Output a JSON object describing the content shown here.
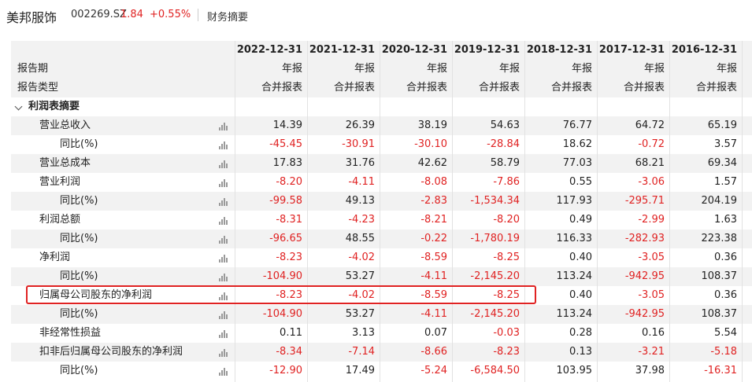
{
  "header": {
    "name": "美邦服饰",
    "code": "002269.SZ",
    "price": "1.84",
    "change": "+0.55%",
    "tab": "财务摘要"
  },
  "table": {
    "dates": [
      "2022-12-31",
      "2021-12-31",
      "2020-12-31",
      "2019-12-31",
      "2018-12-31",
      "2017-12-31",
      "2016-12-31"
    ],
    "period_label": "报告期",
    "period_values": [
      "年报",
      "年报",
      "年报",
      "年报",
      "年报",
      "年报",
      "年报"
    ],
    "type_label": "报告类型",
    "type_values": [
      "合并报表",
      "合并报表",
      "合并报表",
      "合并报表",
      "合并报表",
      "合并报表",
      "合并报表"
    ],
    "section": "利润表摘要",
    "rows": [
      {
        "label": "营业总收入",
        "values": [
          "14.39",
          "26.39",
          "38.19",
          "54.63",
          "76.77",
          "64.72",
          "65.19"
        ]
      },
      {
        "label": "同比(%)",
        "values": [
          "-45.45",
          "-30.91",
          "-30.10",
          "-28.84",
          "18.62",
          "-0.72",
          "3.57"
        ]
      },
      {
        "label": "营业总成本",
        "values": [
          "17.83",
          "31.76",
          "42.62",
          "58.79",
          "77.03",
          "68.21",
          "69.34"
        ]
      },
      {
        "label": "营业利润",
        "values": [
          "-8.20",
          "-4.11",
          "-8.08",
          "-7.86",
          "0.55",
          "-3.06",
          "1.57"
        ]
      },
      {
        "label": "同比(%)",
        "values": [
          "-99.58",
          "49.13",
          "-2.83",
          "-1,534.34",
          "117.93",
          "-295.71",
          "204.19"
        ]
      },
      {
        "label": "利润总额",
        "values": [
          "-8.31",
          "-4.23",
          "-8.21",
          "-8.20",
          "0.49",
          "-2.99",
          "1.63"
        ]
      },
      {
        "label": "同比(%)",
        "values": [
          "-96.65",
          "48.55",
          "-0.22",
          "-1,780.19",
          "116.33",
          "-282.93",
          "223.38"
        ]
      },
      {
        "label": "净利润",
        "values": [
          "-8.23",
          "-4.02",
          "-8.59",
          "-8.25",
          "0.40",
          "-3.05",
          "0.36"
        ]
      },
      {
        "label": "同比(%)",
        "values": [
          "-104.90",
          "53.27",
          "-4.11",
          "-2,145.20",
          "113.24",
          "-942.95",
          "108.37"
        ]
      },
      {
        "label": "归属母公司股东的净利润",
        "values": [
          "-8.23",
          "-4.02",
          "-8.59",
          "-8.25",
          "0.40",
          "-3.05",
          "0.36"
        ]
      },
      {
        "label": "同比(%)",
        "values": [
          "-104.90",
          "53.27",
          "-4.11",
          "-2,145.20",
          "113.24",
          "-942.95",
          "108.37"
        ]
      },
      {
        "label": "非经常性损益",
        "values": [
          "0.11",
          "3.13",
          "0.07",
          "-0.03",
          "0.28",
          "0.16",
          "5.54"
        ]
      },
      {
        "label": "扣非后归属母公司股东的净利润",
        "values": [
          "-8.34",
          "-7.14",
          "-8.66",
          "-8.23",
          "0.13",
          "-3.21",
          "-5.18"
        ]
      },
      {
        "label": "同比(%)",
        "values": [
          "-12.90",
          "17.49",
          "-5.24",
          "-6,584.50",
          "103.95",
          "37.98",
          "-16.31"
        ]
      }
    ],
    "highlighted_row": "归属母公司股东的净利润"
  },
  "colors": {
    "negative": "#e02222",
    "positive": "#222222",
    "highlight_border": "#e02222",
    "stripe": "#f2f2f2"
  },
  "icons": {
    "row_chart": "bar-chart-icon",
    "section_toggle": "chevron-down-icon"
  }
}
